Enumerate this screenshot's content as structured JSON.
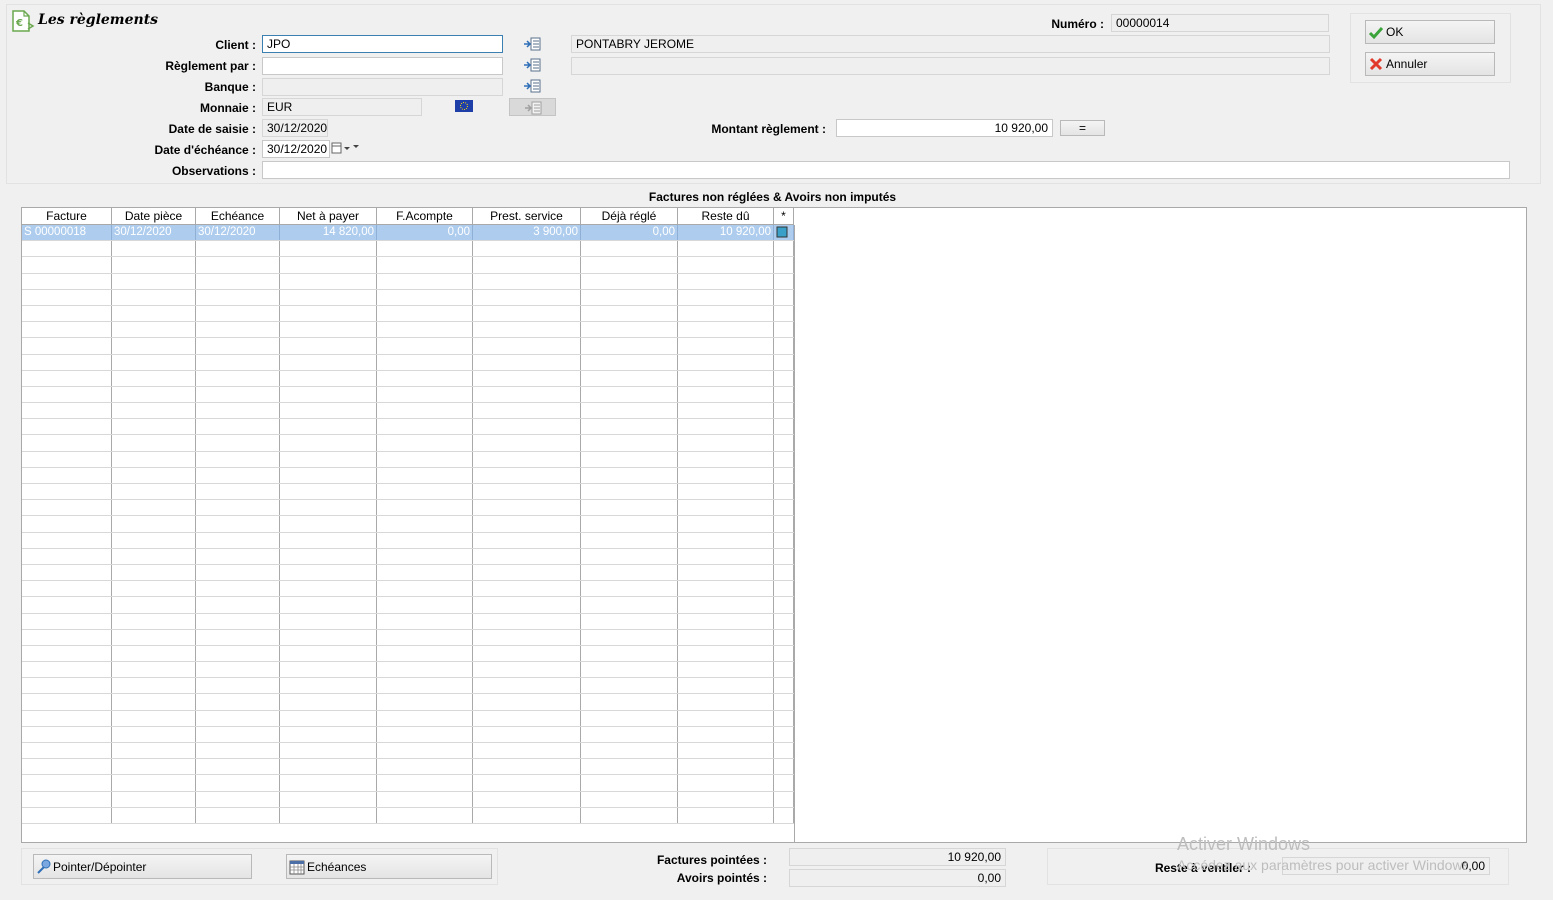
{
  "window": {
    "title": "Les règlements"
  },
  "form": {
    "client_label": "Client :",
    "client_value": "JPO",
    "client_name": "PONTABRY JEROME",
    "reglement_par_label": "Règlement par :",
    "reglement_par_value": "",
    "banque_label": "Banque :",
    "banque_value": "",
    "monnaie_label": "Monnaie :",
    "monnaie_value": "EUR",
    "date_saisie_label": "Date de saisie :",
    "date_saisie_value": "30/12/2020",
    "date_echeance_label": "Date d'échéance :",
    "date_echeance_value": "30/12/2020",
    "observations_label": "Observations :",
    "observations_value": "",
    "numero_label": "Numéro :",
    "numero_value": "00000014",
    "montant_label": "Montant règlement :",
    "montant_value": "10 920,00",
    "equals_button": "="
  },
  "actions": {
    "ok": "OK",
    "annuler": "Annuler"
  },
  "grid": {
    "title": "Factures non réglées & Avoirs non imputés",
    "columns": [
      "Facture",
      "Date pièce",
      "Echéance",
      "Net à payer",
      "F.Acompte",
      "Prest. service",
      "Déjà réglé",
      "Reste dû",
      "*"
    ],
    "rows": [
      [
        "S 00000018",
        "30/12/2020",
        "30/12/2020",
        "14 820,00",
        "0,00",
        "3 900,00",
        "0,00",
        "10 920,00",
        ""
      ]
    ],
    "selection_color": "#aecdee"
  },
  "footer": {
    "pointer_button": "Pointer/Dépointer",
    "echeances_button": "Echéances",
    "factures_pointees_label": "Factures pointées :",
    "factures_pointees_value": "10 920,00",
    "avoirs_pointes_label": "Avoirs pointés :",
    "avoirs_pointes_value": "0,00",
    "reste_label": "Reste à ventiler :",
    "reste_value": "0,00"
  },
  "watermark": {
    "line1": "Activer Windows",
    "line2": "Accédez aux paramètres pour activer Windows."
  },
  "icons": {
    "title": "euro-document-icon",
    "picker": "list-picker-icon",
    "currency": "eu-flag-icon",
    "calendar": "calendar-icon",
    "ok": "checkmark-icon",
    "cancel": "red-x-icon",
    "pointer": "pin-icon",
    "echeances": "calendar-grid-icon"
  }
}
